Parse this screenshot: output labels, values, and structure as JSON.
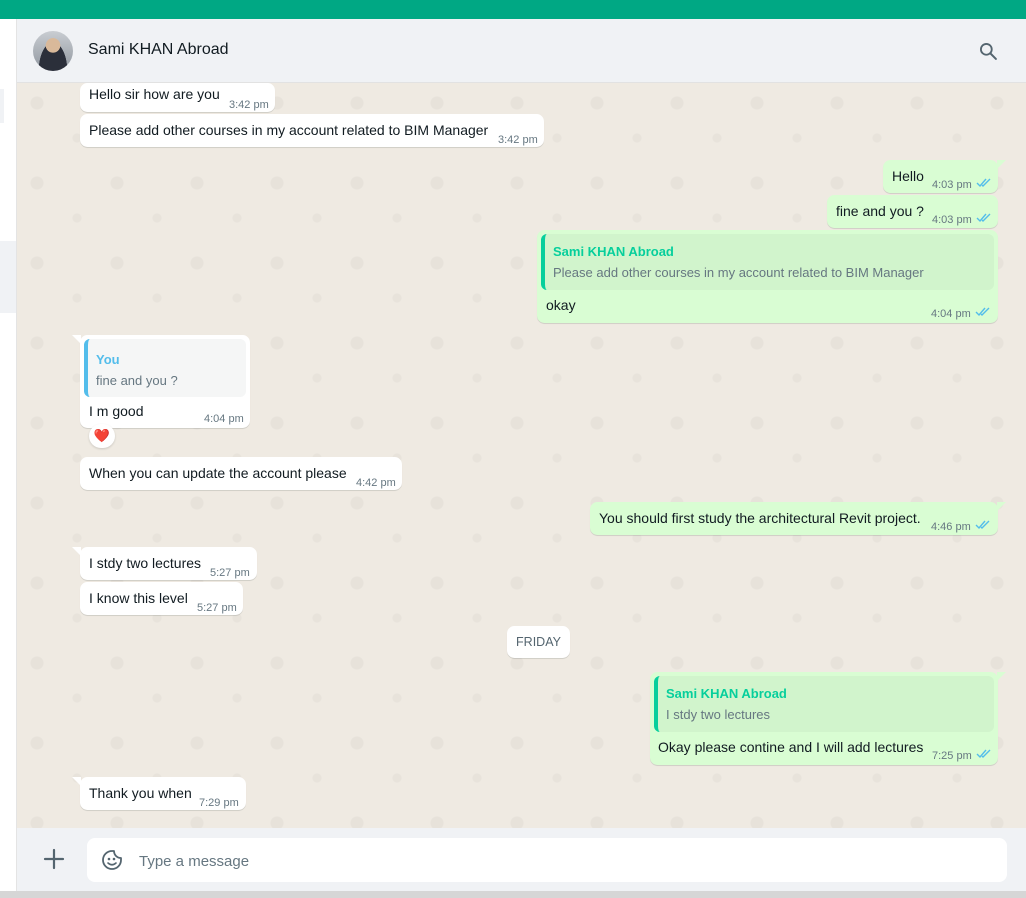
{
  "contact": {
    "name": "Sami KHAN Abroad"
  },
  "messages": [
    {
      "text": "Hello sir how are you",
      "time": "3:42 pm"
    },
    {
      "text": "Please add other courses in my account related to BIM Manager",
      "time": "3:42 pm"
    },
    {
      "text": "Hello",
      "time": "4:03 pm"
    },
    {
      "text": "fine and you ?",
      "time": "4:03 pm"
    },
    {
      "quote_author": "Sami KHAN Abroad",
      "quote_text": "Please add other courses in my account related to BIM Manager",
      "text": "okay",
      "time": "4:04 pm"
    },
    {
      "quote_author": "You",
      "quote_text": "fine and you ?",
      "text": "I m good",
      "time": "4:04 pm",
      "reaction": "❤️"
    },
    {
      "text": "When you can update the account please",
      "time": "4:42 pm"
    },
    {
      "text": "You should first study the architectural Revit project.",
      "time": "4:46 pm"
    },
    {
      "text": "I stdy two lectures",
      "time": "5:27 pm"
    },
    {
      "text": "I know this level",
      "time": "5:27 pm"
    },
    {
      "quote_author": "Sami KHAN Abroad",
      "quote_text": "I stdy two lectures",
      "text": "Okay please contine and I will add lectures",
      "time": "7:25 pm"
    },
    {
      "text": "Thank you when",
      "time": "7:29 pm"
    }
  ],
  "day_divider": "FRIDAY",
  "composer": {
    "placeholder": "Type a message"
  },
  "colors": {
    "accent": "#00a884",
    "outgoing_bubble": "#d9fdd3",
    "read_ticks": "#53bdeb",
    "chat_background": "#efeae2"
  },
  "icons": {
    "search": "search-icon",
    "attach": "plus-icon",
    "sticker": "sticker-icon",
    "read_receipt": "double-check-icon"
  }
}
